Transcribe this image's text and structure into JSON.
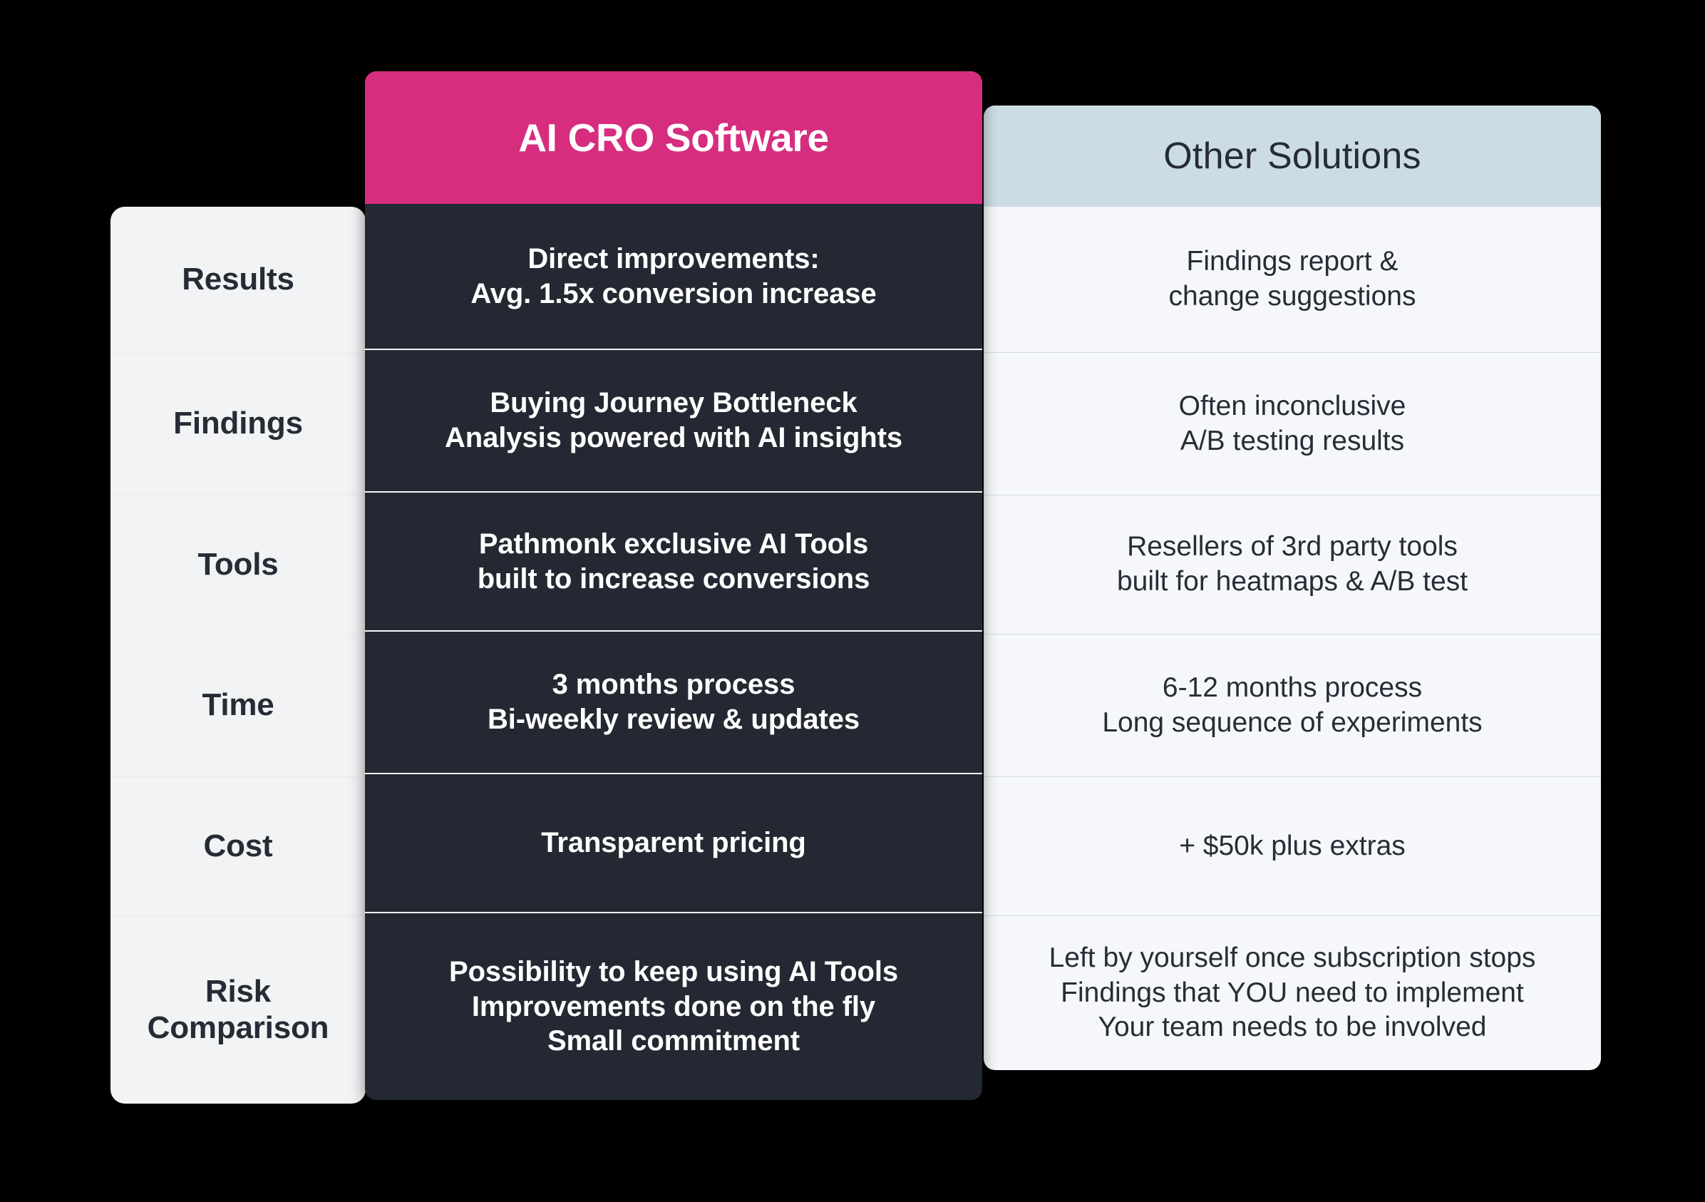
{
  "colors": {
    "background": "#000000",
    "accent_pink": "#d62d7f",
    "dark_panel": "#242832",
    "label_panel": "#f2f3f4",
    "other_header": "#cbdce4",
    "other_body": "#f5f7fa",
    "text_dark": "#262b36",
    "text_light": "#ffffff"
  },
  "columns": {
    "criteria_header": "",
    "main_header": "AI CRO Software",
    "other_header": "Other Solutions"
  },
  "rows": [
    {
      "label": "Results",
      "main": "Direct improvements:\nAvg. 1.5x conversion increase",
      "other": "Findings report &\nchange suggestions"
    },
    {
      "label": "Findings",
      "main": "Buying Journey Bottleneck\nAnalysis powered with AI insights",
      "other": "Often inconclusive\nA/B testing results"
    },
    {
      "label": "Tools",
      "main": "Pathmonk exclusive AI Tools\nbuilt to increase conversions",
      "other": "Resellers of 3rd party tools\nbuilt for heatmaps & A/B test"
    },
    {
      "label": "Time",
      "main": "3 months process\nBi-weekly review & updates",
      "other": "6-12 months process\nLong sequence of experiments"
    },
    {
      "label": "Cost",
      "main": "Transparent pricing",
      "other": "+ $50k plus extras"
    },
    {
      "label": "Risk\nComparison",
      "main": "Possibility to keep using AI Tools\nImprovements done on the fly\nSmall commitment",
      "other": "Left by yourself once subscription stops\nFindings that YOU need to implement\nYour team needs to be involved"
    }
  ]
}
